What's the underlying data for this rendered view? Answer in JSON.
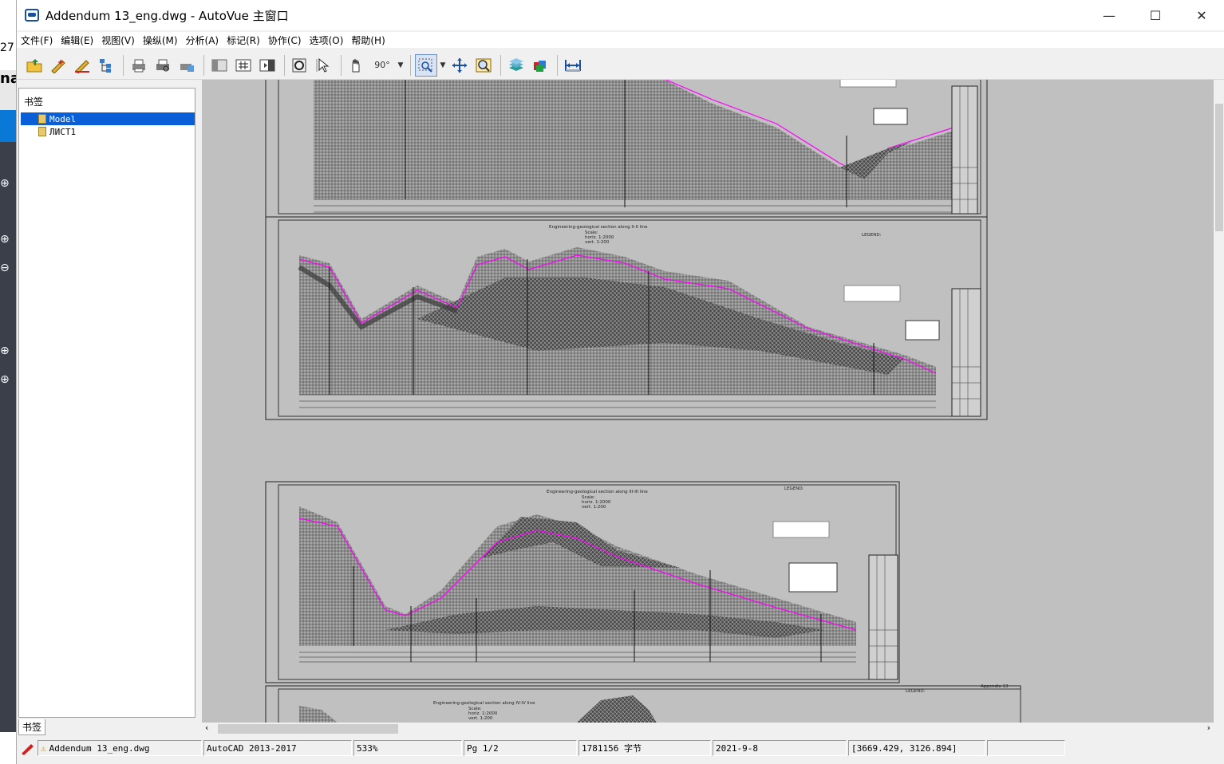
{
  "window": {
    "title": "Addendum 13_eng.dwg - AutoVue 主窗口",
    "controls": {
      "minimize": "—",
      "maximize": "☐",
      "close": "✕"
    }
  },
  "menu": [
    "文件(F)",
    "编辑(E)",
    "视图(V)",
    "操纵(M)",
    "分析(A)",
    "标记(R)",
    "协作(C)",
    "选项(O)",
    "帮助(H)"
  ],
  "toolbar": {
    "buttons": [
      "open-icon",
      "markup-icon",
      "edit-icon",
      "tree-icon",
      "print-icon",
      "print-preview-icon",
      "print-setup-icon",
      "panel-icon",
      "grid-icon",
      "page-icon",
      "zoom-fit-icon",
      "select-icon",
      "pan-icon",
      "rotate-icon",
      "zoom-window-icon",
      "zoom-extents-icon",
      "magnifier-icon",
      "layers-icon",
      "3d-icon",
      "measure-icon"
    ],
    "rotate_label": "90°",
    "accent": "#6b8fc7"
  },
  "left_edge_fragments": {
    "top": "27",
    "middle": "na"
  },
  "bookmarks": {
    "title": "书签",
    "tab_label": "书签",
    "items": [
      {
        "label": "Model",
        "selected": true
      },
      {
        "label": "ЛИСТ1",
        "selected": false
      }
    ]
  },
  "drawing": {
    "section_titles": [
      "Engineering-geological section along II-II line",
      "Engineering-geological section along III-III line",
      "Engineering-geological section along IV-IV line"
    ],
    "scale_label": "Scale:",
    "horiz_label": "horiz. 1:2000",
    "vert_label": "vert. 1:200",
    "legend_label": "LEGEND:",
    "sheet_number": "Appendix 13"
  },
  "status": {
    "file": "Addendum 13_eng.dwg",
    "format": "AutoCAD 2013-2017",
    "zoom": "533%",
    "page": "Pg 1/2",
    "size": "1781156 字节",
    "date": "2021-9-8",
    "coords": "[3669.429, 3126.894]"
  },
  "colors": {
    "selection": "#0a5fd8",
    "canvas": "#c0c0c0",
    "profile_line": "#ff00ff"
  }
}
